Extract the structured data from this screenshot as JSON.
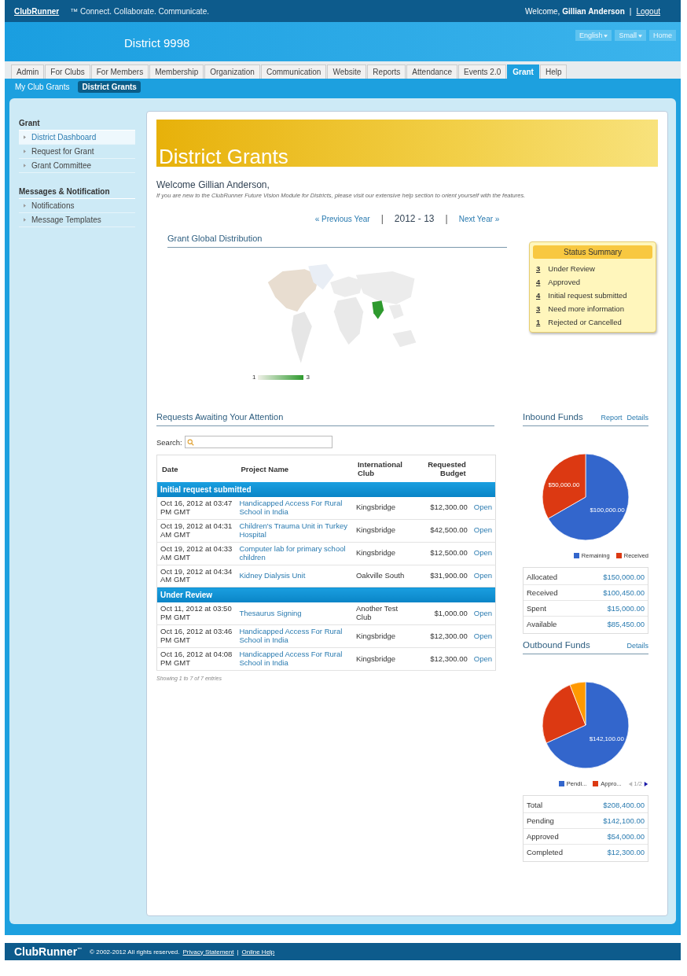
{
  "top_bar": {
    "brand": "ClubRunner",
    "tagline": "™ Connect. Collaborate. Communicate.",
    "welcome": "Welcome,",
    "user": "Gillian Anderson",
    "separator": "|",
    "logout": "Logout"
  },
  "header": {
    "title": "District 9998",
    "buttons": [
      {
        "label": "English",
        "dropdown": true
      },
      {
        "label": "Small",
        "dropdown": true
      },
      {
        "label": "Home",
        "dropdown": false
      }
    ]
  },
  "tabs": [
    {
      "label": "Admin",
      "selected": false
    },
    {
      "label": "For Clubs",
      "selected": false
    },
    {
      "label": "For Members",
      "selected": false
    },
    {
      "label": "Membership",
      "selected": false
    },
    {
      "label": "Organization",
      "selected": false
    },
    {
      "label": "Communication",
      "selected": false
    },
    {
      "label": "Website",
      "selected": false
    },
    {
      "label": "Reports",
      "selected": false
    },
    {
      "label": "Attendance",
      "selected": false
    },
    {
      "label": "Events 2.0",
      "selected": false
    },
    {
      "label": "Grant",
      "selected": true
    },
    {
      "label": "Help",
      "selected": false
    }
  ],
  "subtabs": [
    {
      "label": "My Club Grants",
      "selected": false
    },
    {
      "label": "District Grants",
      "selected": true
    }
  ],
  "sidebar": [
    {
      "heading": "Grant",
      "items": [
        {
          "label": "District Dashboard",
          "selected": true
        },
        {
          "label": "Request for Grant",
          "selected": false
        },
        {
          "label": "Grant Committee",
          "selected": false
        }
      ]
    },
    {
      "heading": "Messages & Notification",
      "items": [
        {
          "label": "Notifications",
          "selected": false
        },
        {
          "label": "Message Templates",
          "selected": false
        }
      ]
    }
  ],
  "banner": {
    "title": "District Grants"
  },
  "welcome": {
    "greeting": "Welcome Gillian Anderson,",
    "intro": "If you are new to the ClubRunner Future Vision Module for Districts, please visit our extensive help section to orient yourself with the features."
  },
  "year_nav": {
    "previous": "« Previous Year",
    "current": "2012 - 13",
    "separator": "|",
    "next": "Next Year »"
  },
  "distribution": {
    "title": "Grant Global Distribution",
    "scale_min": "1",
    "scale_max": "3"
  },
  "status_summary": {
    "title": "Status Summary",
    "items": [
      {
        "count": "3",
        "label": "Under Review"
      },
      {
        "count": "4",
        "label": "Approved"
      },
      {
        "count": "4",
        "label": "Initial request submitted"
      },
      {
        "count": "3",
        "label": "Need more information"
      },
      {
        "count": "1",
        "label": "Rejected or Cancelled"
      }
    ]
  },
  "requests": {
    "title": "Requests Awaiting Your Attention",
    "search_label": "Search:",
    "columns": [
      "Date",
      "Project Name",
      "International Club",
      "Requested Budget"
    ],
    "groups": [
      {
        "name": "Initial request submitted",
        "rows": [
          {
            "date": "Oct 16, 2012 at 03:47 PM GMT",
            "project": "Handicapped Access For Rural School in India",
            "club": "Kingsbridge",
            "budget": "$12,300.00",
            "action": "Open"
          },
          {
            "date": "Oct 19, 2012 at 04:31 AM GMT",
            "project": "Children's Trauma Unit in Turkey Hospital",
            "club": "Kingsbridge",
            "budget": "$42,500.00",
            "action": "Open"
          },
          {
            "date": "Oct 19, 2012 at 04:33 AM GMT",
            "project": "Computer lab for primary school children",
            "club": "Kingsbridge",
            "budget": "$12,500.00",
            "action": "Open"
          },
          {
            "date": "Oct 19, 2012 at 04:34 AM GMT",
            "project": "Kidney Dialysis Unit",
            "club": "Oakville South",
            "budget": "$31,900.00",
            "action": "Open"
          }
        ]
      },
      {
        "name": "Under Review",
        "rows": [
          {
            "date": "Oct 11, 2012 at 03:50 PM GMT",
            "project": "Thesaurus Signing",
            "club": "Another Test Club",
            "budget": "$1,000.00",
            "action": "Open"
          },
          {
            "date": "Oct 16, 2012 at 03:46 PM GMT",
            "project": "Handicapped Access For Rural School in India",
            "club": "Kingsbridge",
            "budget": "$12,300.00",
            "action": "Open"
          },
          {
            "date": "Oct 16, 2012 at 04:08 PM GMT",
            "project": "Handicapped Access For Rural School in India",
            "club": "Kingsbridge",
            "budget": "$12,300.00",
            "action": "Open"
          }
        ]
      }
    ],
    "footer": "Showing 1 to 7 of 7 entries"
  },
  "funds": [
    {
      "title": "Inbound Funds",
      "links": [
        "Report",
        "Details"
      ],
      "chart_data": {
        "type": "pie",
        "categories": [
          "Remaining",
          "Received"
        ],
        "series": [
          {
            "values": [
              66.7,
              33.3
            ]
          }
        ],
        "colors": [
          "#3366cc",
          "#dc3912"
        ],
        "value_labels": [
          "$100,000.00",
          "$50,000.00"
        ],
        "legend": "bottom"
      },
      "summary": [
        {
          "label": "Allocated",
          "value": "$150,000.00"
        },
        {
          "label": "Received",
          "value": "$100,450.00"
        },
        {
          "label": "Spent",
          "value": "$15,000.00"
        },
        {
          "label": "Available",
          "value": "$85,450.00"
        }
      ]
    },
    {
      "title": "Outbound Funds",
      "links": [
        "Details"
      ],
      "chart_data": {
        "type": "pie",
        "series": [
          {
            "values": [
              68.19,
              25.91,
              5.9
            ]
          }
        ],
        "colors": [
          "#3366cc",
          "#dc3912",
          "#ff9900"
        ],
        "value_labels": [
          "$142,100.00",
          null,
          null
        ]
      },
      "legend": [
        "Pendi...",
        "Appro..."
      ],
      "pager": "1/2",
      "summary": [
        {
          "label": "Total",
          "value": "$208,400.00"
        },
        {
          "label": "Pending",
          "value": "$142,100.00"
        },
        {
          "label": "Approved",
          "value": "$54,000.00"
        },
        {
          "label": "Completed",
          "value": "$12,300.00"
        }
      ]
    }
  ],
  "footer": {
    "brand": "ClubRunner",
    "tm": "™",
    "copyright": "© 2002-2012 All rights reserved.",
    "privacy": "Privacy Statement",
    "separator": "|",
    "help": "Online Help"
  }
}
